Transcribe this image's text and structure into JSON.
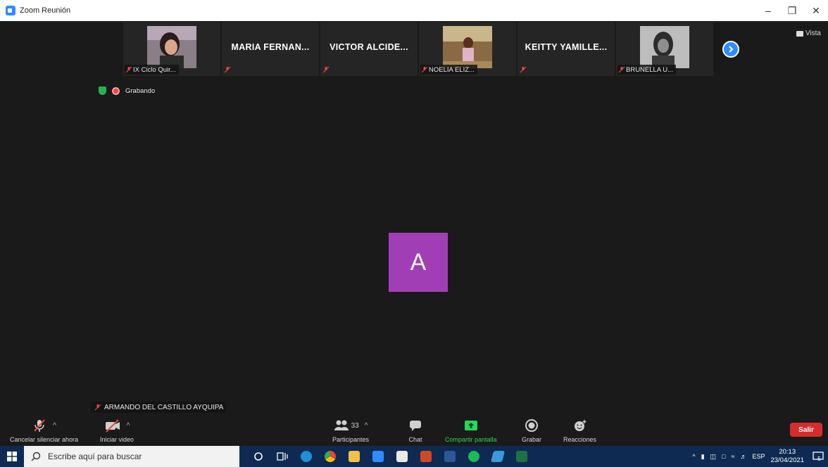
{
  "window": {
    "title": "Zoom Reunión"
  },
  "strip": {
    "tiles": [
      {
        "type": "photo",
        "caption": "IX Ciclo Quir..."
      },
      {
        "type": "name",
        "name": "MARIA FERNAN..."
      },
      {
        "type": "name",
        "name": "VICTOR ALCIDE..."
      },
      {
        "type": "photo",
        "caption": "NOELIA ELIZ..."
      },
      {
        "type": "name",
        "name": "KEITTY YAMILLE..."
      },
      {
        "type": "photo",
        "caption": "BRUNELLA U..."
      }
    ]
  },
  "view_label": "Vista",
  "recording_label": "Grabando",
  "active_speaker": {
    "initial": "A",
    "name": "ARMANDO DEL CASTILLO AYQUIPA",
    "color": "#a23eb5"
  },
  "controls": {
    "mute_label": "Cancelar silenciar ahora",
    "video_label": "Iniciar video",
    "participants_label": "Participantes",
    "participants_count": "33",
    "chat_label": "Chat",
    "share_label": "Compartir pantalla",
    "record_label": "Grabar",
    "reactions_label": "Reacciones",
    "leave_label": "Salir"
  },
  "taskbar": {
    "search_placeholder": "Escribe aquí para buscar",
    "language": "ESP",
    "time": "20:13",
    "date": "23/04/2021",
    "notification_count": "5"
  },
  "colors": {
    "accent": "#2d8cff",
    "share_green": "#23d959",
    "leave_red": "#d72c2c",
    "taskbar": "#0e2a52"
  }
}
